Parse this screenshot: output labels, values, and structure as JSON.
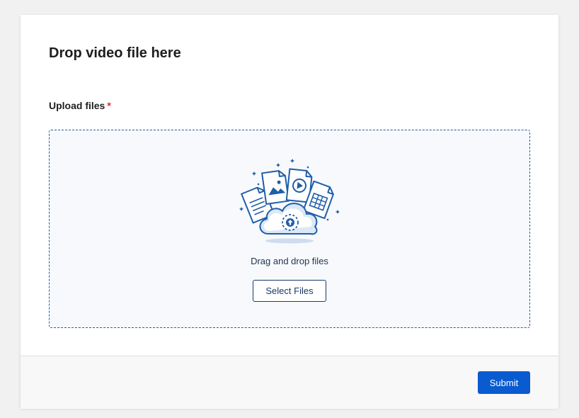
{
  "card": {
    "title": "Drop video file here"
  },
  "upload": {
    "label": "Upload files",
    "required_marker": "*",
    "drop_text": "Drag and drop files",
    "select_button_label": "Select Files",
    "illustration_icon": "cloud-upload-files-icon"
  },
  "footer": {
    "submit_label": "Submit"
  },
  "colors": {
    "accent": "#0a5bd0",
    "dropzone_border": "#1f5ea8",
    "required": "#e5243b"
  }
}
